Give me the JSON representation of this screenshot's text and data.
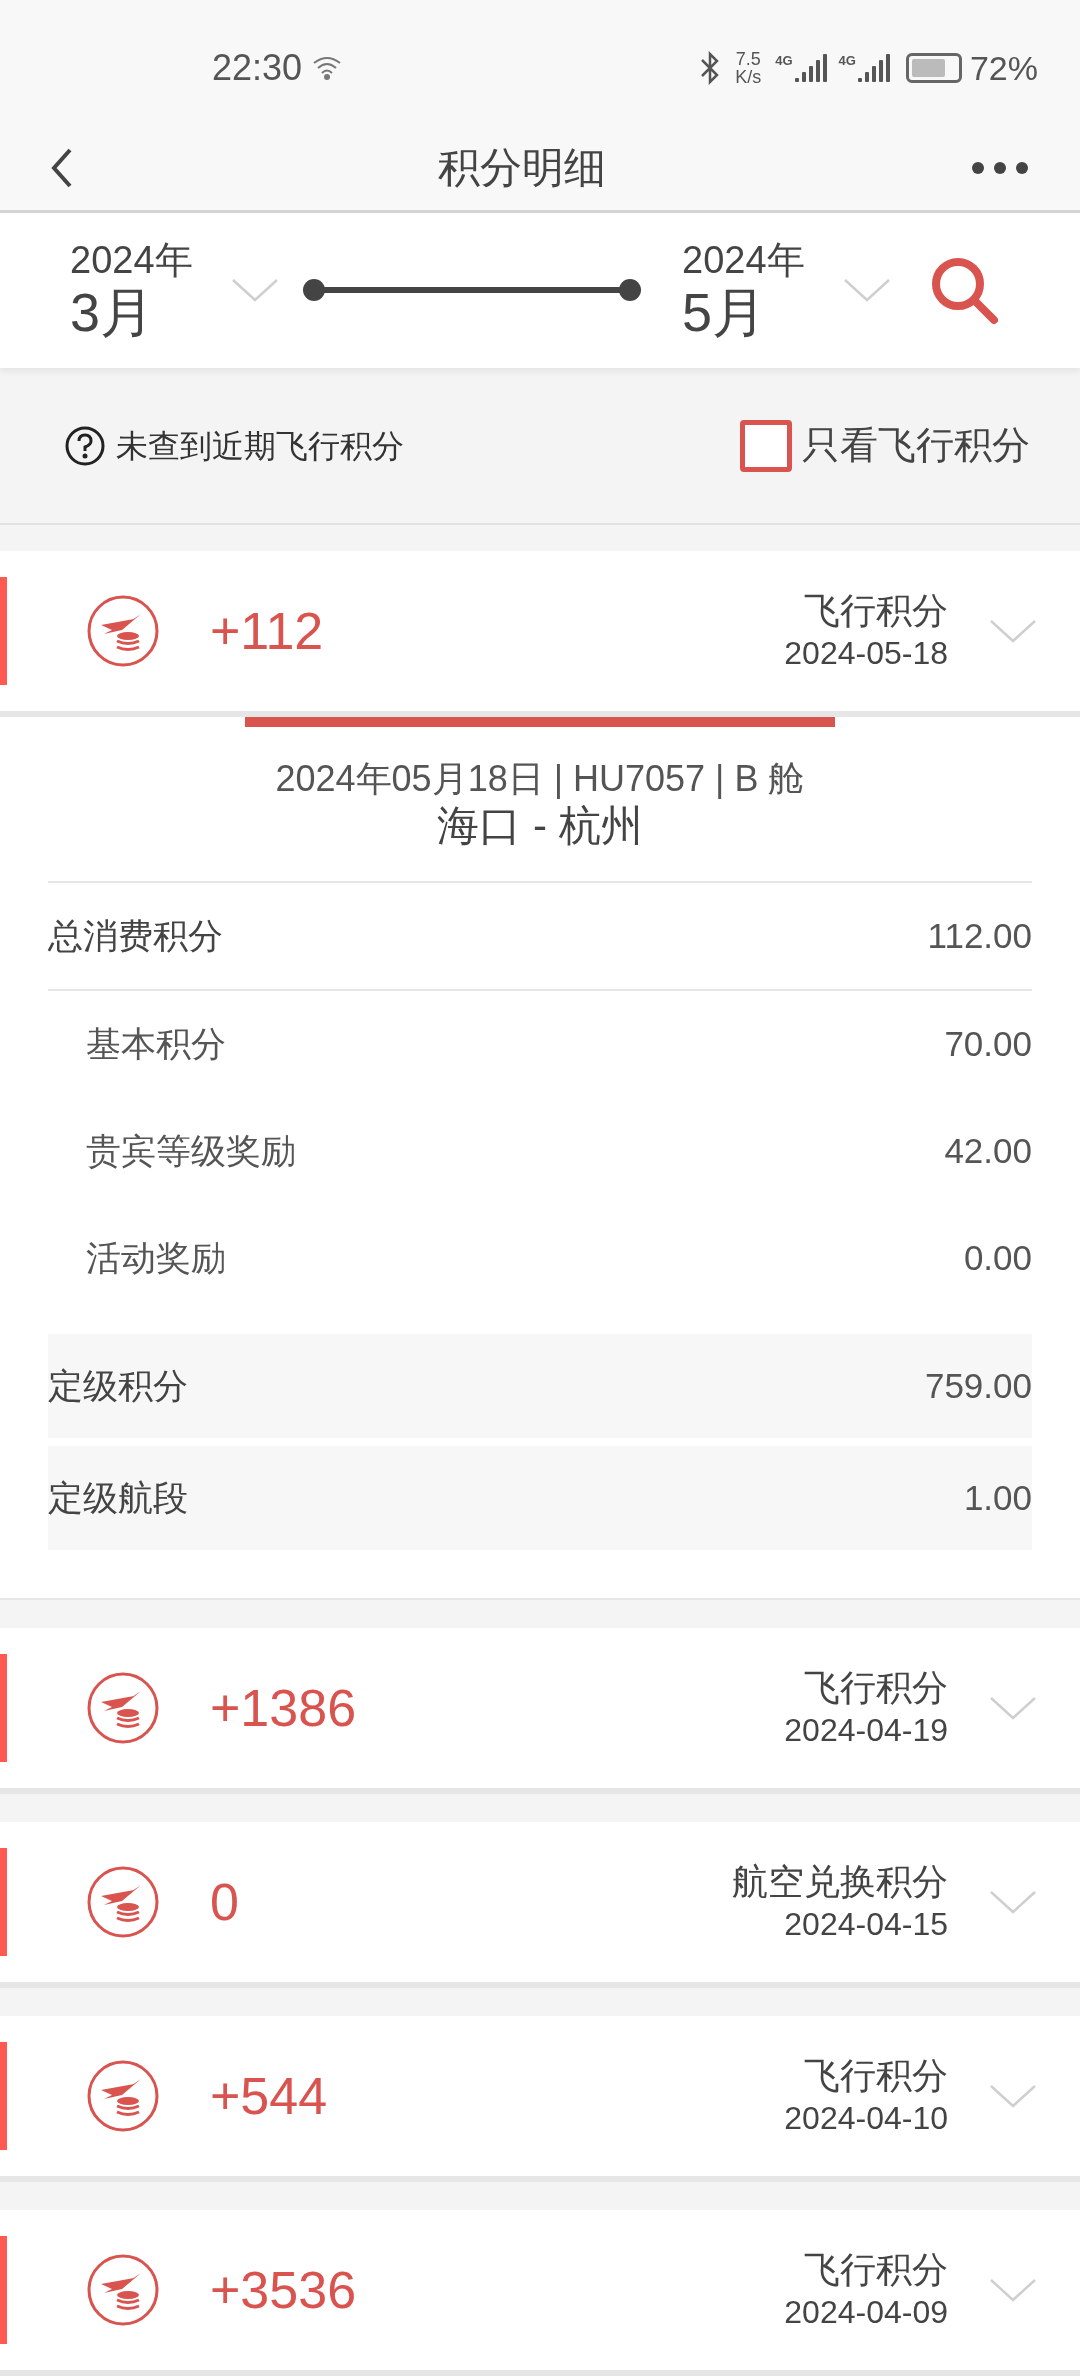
{
  "status_bar": {
    "time": "22:30",
    "speed_value": "7.5",
    "speed_unit": "K/s",
    "network": [
      "4G",
      "4G"
    ],
    "battery": "72%"
  },
  "header": {
    "title": "积分明细"
  },
  "filter": {
    "start": {
      "year": "2024年",
      "month": "3月"
    },
    "end": {
      "year": "2024年",
      "month": "5月"
    }
  },
  "notice": {
    "text": "未查到近期飞行积分"
  },
  "flight_only": {
    "label": "只看飞行积分",
    "checked": false
  },
  "records": [
    {
      "amount": "+112",
      "type": "飞行积分",
      "date": "2024-05-18",
      "detail": {
        "flight_line": "2024年05月18日 | HU7057 | B 舱",
        "route": "海口 - 杭州",
        "total": {
          "label": "总消费积分",
          "value": "112.00"
        },
        "items": [
          {
            "label": "基本积分",
            "value": "70.00"
          },
          {
            "label": "贵宾等级奖励",
            "value": "42.00"
          },
          {
            "label": "活动奖励",
            "value": "0.00"
          }
        ],
        "grading": [
          {
            "label": "定级积分",
            "value": "759.00"
          },
          {
            "label": "定级航段",
            "value": "1.00"
          }
        ]
      }
    },
    {
      "amount": "+1386",
      "type": "飞行积分",
      "date": "2024-04-19"
    },
    {
      "amount": "0",
      "type": "航空兑换积分",
      "date": "2024-04-15"
    },
    {
      "amount": "+544",
      "type": "飞行积分",
      "date": "2024-04-10"
    },
    {
      "amount": "+3536",
      "type": "飞行积分",
      "date": "2024-04-09"
    }
  ]
}
